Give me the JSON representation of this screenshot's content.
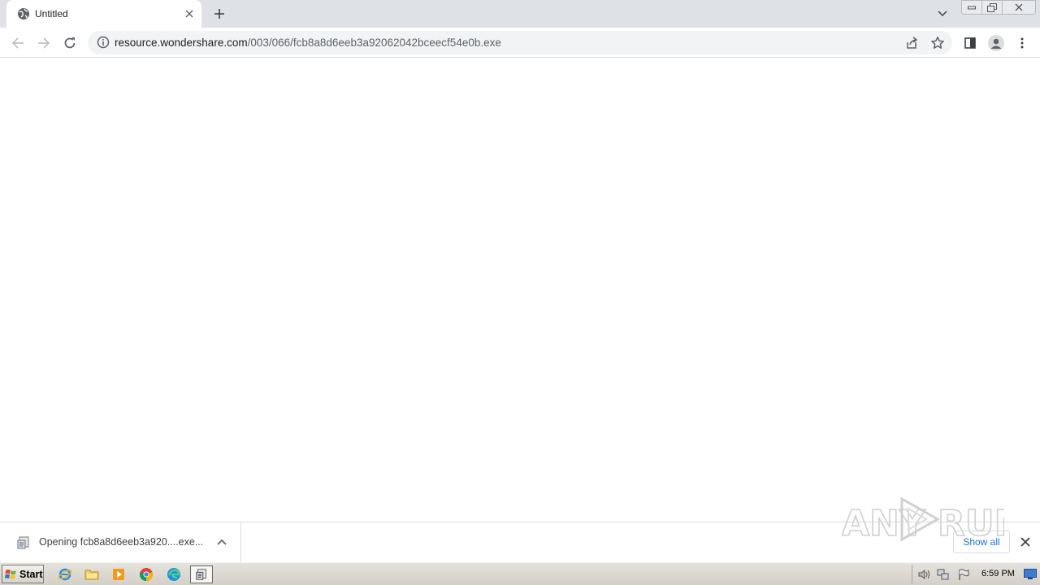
{
  "browser": {
    "tab": {
      "title": "Untitled"
    },
    "omnibox": {
      "url_host": "resource.wondershare.com",
      "url_path": "/003/066/fcb8a8d6eeb3a92062042bceecf54e0b.exe"
    }
  },
  "download_shelf": {
    "item_label": "Opening fcb8a8d6eeb3a920....exe...",
    "show_all_label": "Show all"
  },
  "watermark": {
    "text_left": "ANY",
    "text_right": "RUN"
  },
  "taskbar": {
    "start_label": "Start",
    "clock": "6:59 PM",
    "apps": [
      "internet-explorer-icon",
      "folder-icon",
      "media-player-icon",
      "chrome-icon",
      "edge-icon",
      "installer-icon"
    ]
  },
  "colors": {
    "tabstrip": "#dee1e6",
    "omnibox": "#f1f3f4",
    "link_blue": "#1a73e8",
    "taskbar": "#d4d0c8"
  }
}
